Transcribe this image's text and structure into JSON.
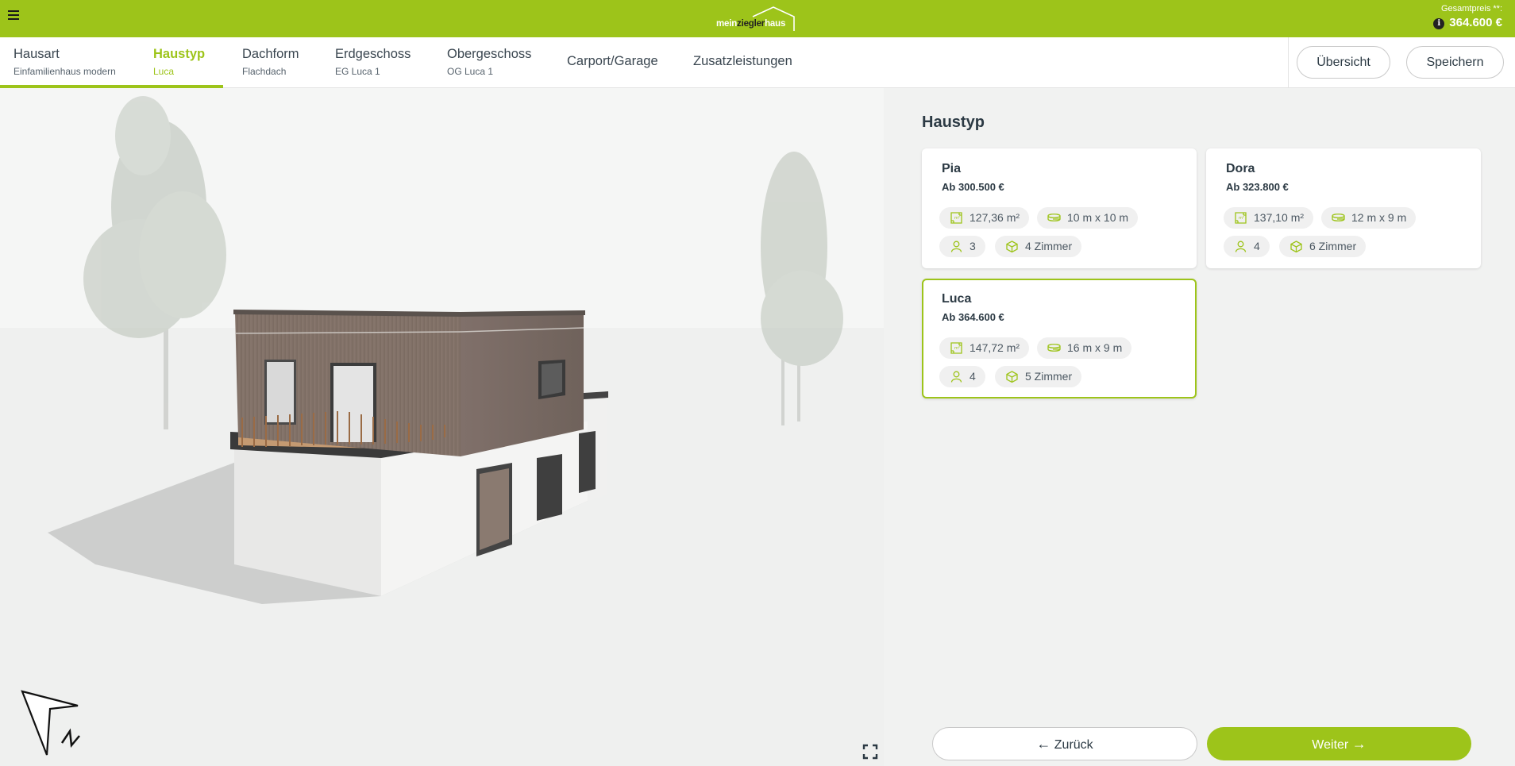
{
  "header": {
    "logo": {
      "part1": "mein",
      "part2": "ziegler",
      "part3": "haus"
    },
    "price_label": "Gesamtpreis **:",
    "price_value": "364.600 €",
    "accent_color": "#9dc41a"
  },
  "nav": {
    "tabs": [
      {
        "title": "Hausart",
        "subtitle": "Einfamilienhaus modern"
      },
      {
        "title": "Haustyp",
        "subtitle": "Luca"
      },
      {
        "title": "Dachform",
        "subtitle": "Flachdach"
      },
      {
        "title": "Erdgeschoss",
        "subtitle": "EG Luca 1"
      },
      {
        "title": "Obergeschoss",
        "subtitle": "OG Luca 1"
      },
      {
        "title": "Carport/Garage"
      },
      {
        "title": "Zusatzleistungen"
      }
    ],
    "active_tab": "Haustyp",
    "overview_label": "Übersicht",
    "save_label": "Speichern"
  },
  "panel": {
    "title": "Haustyp",
    "cards": [
      {
        "name": "Pia",
        "price": "Ab 300.500 €",
        "area": "127,36 m²",
        "size": "10 m x 10 m",
        "persons": "3",
        "rooms": "4 Zimmer"
      },
      {
        "name": "Dora",
        "price": "Ab 323.800 €",
        "area": "137,10 m²",
        "size": "12 m x 9 m",
        "persons": "4",
        "rooms": "6 Zimmer"
      },
      {
        "name": "Luca",
        "price": "Ab 364.600 €",
        "area": "147,72 m²",
        "size": "16 m x 9 m",
        "persons": "4",
        "rooms": "5 Zimmer",
        "selected": true
      }
    ]
  },
  "footer": {
    "back_label": "Zurück",
    "next_label": "Weiter"
  }
}
